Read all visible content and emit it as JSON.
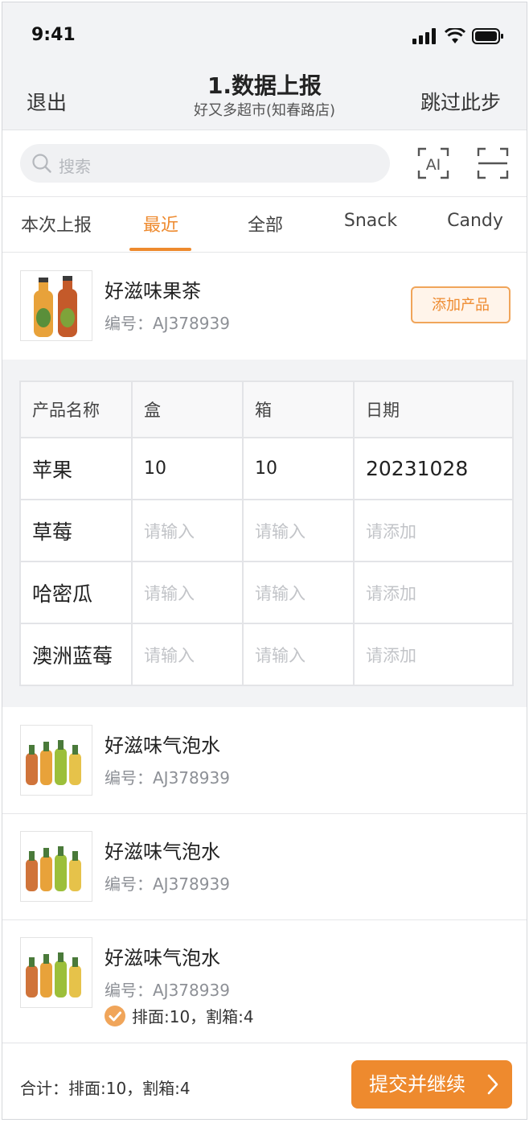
{
  "status_bar": {
    "time": "9:41"
  },
  "nav": {
    "left": "退出",
    "title": "1.数据上报",
    "subtitle": "好又多超市(知春路店)",
    "right": "跳过此步"
  },
  "search": {
    "placeholder": "搜索",
    "ai_icon_text": "AI"
  },
  "tabs": [
    "本次上报",
    "最近",
    "全部",
    "Snack",
    "Candy"
  ],
  "active_tab": "最近",
  "expanded_product": {
    "name": "好滋味果茶",
    "code": "编号：AJ378939",
    "add_button": "添加产品"
  },
  "grid": {
    "headers": [
      "产品名称",
      "盒",
      "箱",
      "日期"
    ],
    "rows": [
      {
        "name": "苹果",
        "box": "10",
        "case": "10",
        "date": "20231028"
      },
      {
        "name": "草莓",
        "box": "请输入",
        "case": "请输入",
        "date": "请添加"
      },
      {
        "name": "哈密瓜",
        "box": "请输入",
        "case": "请输入",
        "date": "请添加"
      },
      {
        "name": "澳洲蓝莓",
        "box": "请输入",
        "case": "请输入",
        "date": "请添加"
      }
    ]
  },
  "products": [
    {
      "name": "好滋味气泡水",
      "code": "编号：AJ378939"
    },
    {
      "name": "好滋味气泡水",
      "code": "编号：AJ378939"
    },
    {
      "name": "好滋味气泡水",
      "code": "编号：AJ378939",
      "status": "排面:10，割箱:4"
    }
  ],
  "footer": {
    "summary": "合计：排面:10，割箱:4",
    "submit": "提交并继续"
  },
  "colors": {
    "accent": "#ee8a2e",
    "background": "#f2f3f5",
    "placeholder": "#c2c4c8"
  }
}
